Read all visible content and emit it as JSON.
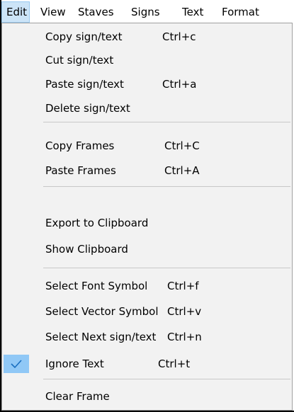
{
  "menubar": {
    "items": [
      {
        "label": "Edit",
        "active": true
      },
      {
        "label": "View"
      },
      {
        "label": "Staves"
      },
      {
        "label": "Signs"
      },
      {
        "label": "Text"
      },
      {
        "label": "Format"
      }
    ]
  },
  "dropdown": {
    "groups": [
      [
        {
          "label": "Copy sign/text",
          "shortcut": "Ctrl+c"
        },
        {
          "label": "Cut sign/text",
          "shortcut": ""
        },
        {
          "label": "Paste sign/text",
          "shortcut": "Ctrl+a"
        },
        {
          "label": "Delete sign/text",
          "shortcut": ""
        }
      ],
      [
        {
          "label": "Copy Frames",
          "shortcut": "Ctrl+C"
        },
        {
          "label": "Paste Frames",
          "shortcut": "Ctrl+A"
        }
      ],
      [
        {
          "label": "Export to Clipboard",
          "shortcut": ""
        },
        {
          "label": "Show Clipboard",
          "shortcut": ""
        }
      ],
      [
        {
          "label": "Select Font Symbol",
          "shortcut": "Ctrl+f"
        },
        {
          "label": "Select Vector Symbol",
          "shortcut": "Ctrl+v"
        },
        {
          "label": "Select Next sign/text",
          "shortcut": "Ctrl+n"
        },
        {
          "label": "Ignore Text",
          "shortcut": "Ctrl+t",
          "checked": true,
          "check_icon": "checkmark-icon"
        }
      ],
      [
        {
          "label": "Clear Frame",
          "shortcut": ""
        }
      ]
    ]
  },
  "colors": {
    "menu_background": "#f2f2f2",
    "active_menubar_item": "#cce4f7",
    "checked_item_highlight": "#90c8f6",
    "separator": "#c8c8c8"
  }
}
